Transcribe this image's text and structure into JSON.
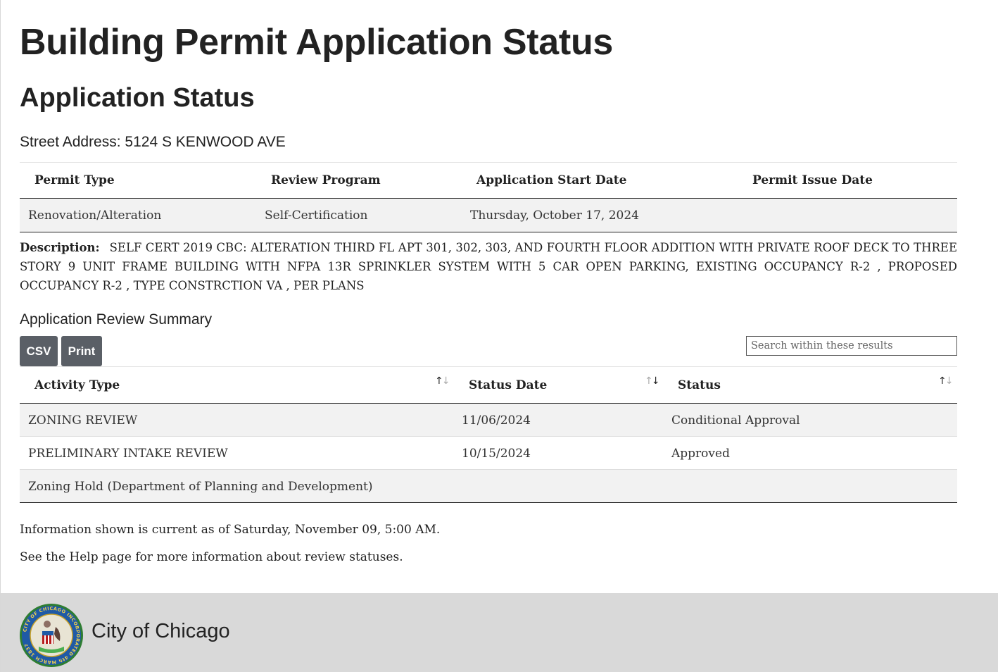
{
  "page": {
    "title": "Building Permit Application Status",
    "subtitle": "Application Status",
    "street_address": "Street Address: 5124 S KENWOOD AVE"
  },
  "permit_table": {
    "headers": [
      "Permit Type",
      "Review Program",
      "Application Start Date",
      "Permit Issue Date"
    ],
    "row": [
      "Renovation/Alteration",
      "Self-Certification",
      "Thursday, October 17, 2024",
      ""
    ]
  },
  "description": {
    "label": "Description:",
    "text": "SELF CERT 2019 CBC: ALTERATION THIRD FL APT 301, 302, 303, AND FOURTH FLOOR ADDITION WITH PRIVATE ROOF DECK TO THREE STORY 9 UNIT FRAME BUILDING WITH NFPA 13R SPRINKLER SYSTEM WITH 5 CAR OPEN PARKING, EXISTING OCCUPANCY R-2 , PROPOSED OCCUPANCY R-2 , TYPE CONSTRCTION VA , PER PLANS"
  },
  "review_summary": {
    "title": "Application Review Summary",
    "csv_label": "CSV",
    "print_label": "Print",
    "search_placeholder": "Search within these results",
    "headers": [
      "Activity Type",
      "Status Date",
      "Status"
    ],
    "sort_icons": [
      "sort-icon",
      "sort-desc-icon",
      "sort-icon"
    ],
    "rows": [
      [
        "ZONING REVIEW",
        "11/06/2024",
        "Conditional Approval"
      ],
      [
        "PRELIMINARY INTAKE REVIEW",
        "10/15/2024",
        "Approved"
      ],
      [
        "Zoning Hold (Department of Planning and Development)",
        "",
        ""
      ]
    ]
  },
  "info": {
    "current_as_of": "Information shown is current as of Saturday, November 09, 5:00 AM.",
    "help_note": "See the Help page for more information about review statuses."
  },
  "footer": {
    "city_name": "City of Chicago",
    "seal_text": "CITY OF CHICAGO INCORPORATED 4th MARCH 1837"
  },
  "colors": {
    "button_bg": "#5a5f66",
    "footer_bg": "#d9d9d9",
    "row_stripe": "#f2f2f2",
    "seal_blue": "#1f5aa6",
    "seal_green": "#2e7d32"
  }
}
